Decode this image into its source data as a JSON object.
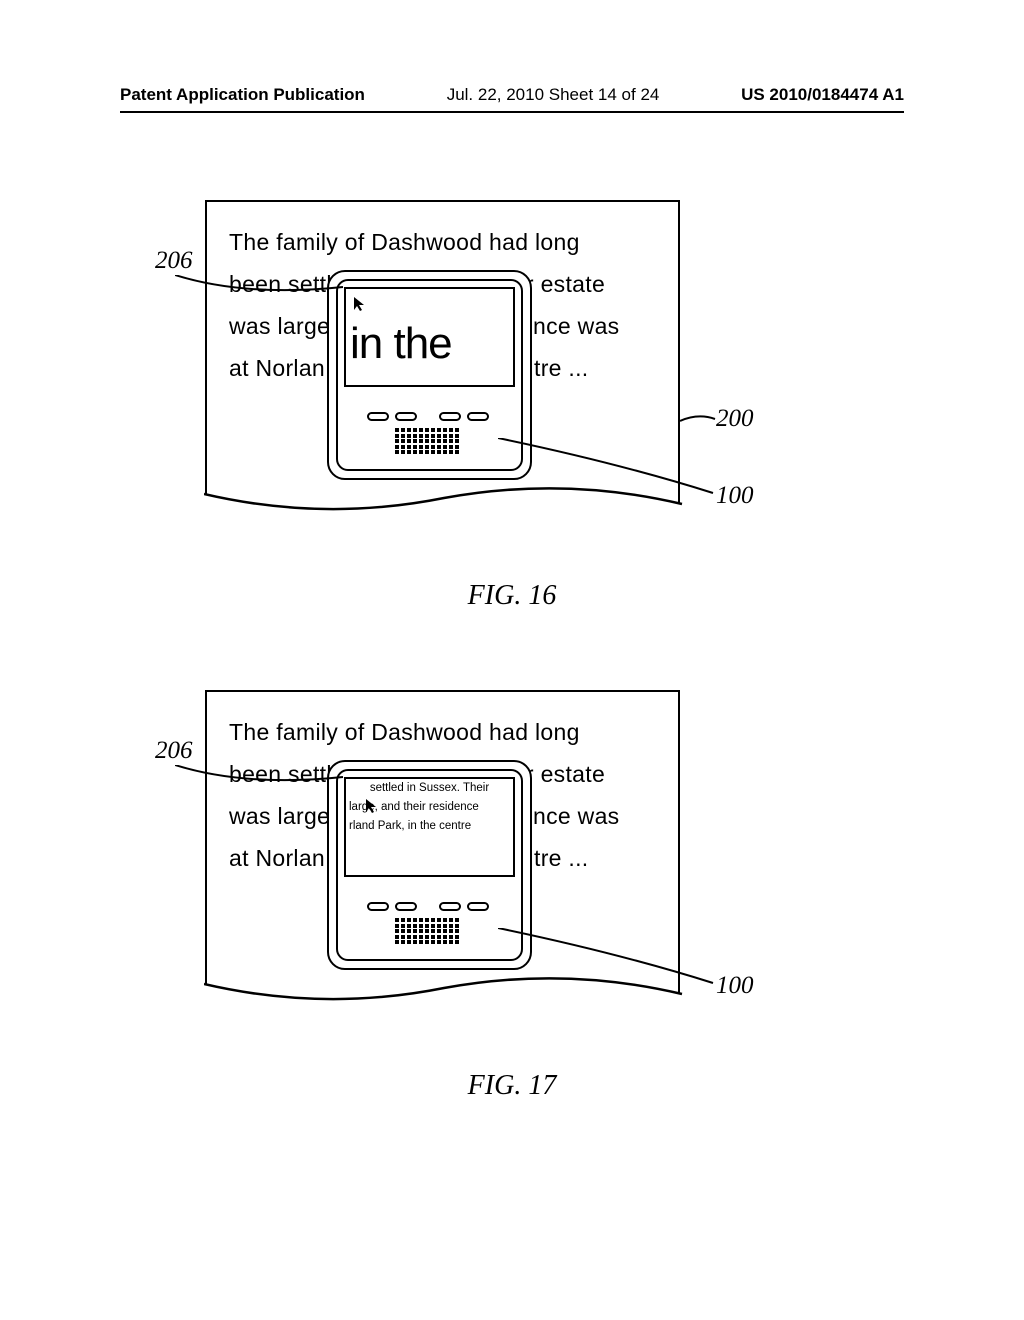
{
  "header": {
    "left": "Patent Application Publication",
    "center": "Jul. 22, 2010   Sheet 14 of 24",
    "right": "US 2010/0184474 A1"
  },
  "fig16": {
    "label": "FIG. 16",
    "paragraph_l1": "The family of Dashwood had long",
    "paragraph_l2": "been settled in Sussex. Their estate",
    "paragraph_l3a": "was large",
    "paragraph_l3b": "nce was",
    "paragraph_l4a": "at Norlan",
    "paragraph_l4b": "tre ...",
    "magnified": "in the",
    "ref_206": "206",
    "ref_200": "200",
    "ref_100": "100"
  },
  "fig17": {
    "label": "FIG. 17",
    "paragraph_l1": "The family of Dashwood had long",
    "paragraph_l2": "been settled in Sussex. Their estate",
    "paragraph_l3a": "was large",
    "paragraph_l3b": "nce was",
    "paragraph_l4a": "at Norlan",
    "paragraph_l4b": "tre ...",
    "small_l1": "settled in Sussex. Their",
    "small_l2": "large, and their residence",
    "small_l3": "rland Park, in the centre",
    "ref_206": "206",
    "ref_100": "100"
  }
}
